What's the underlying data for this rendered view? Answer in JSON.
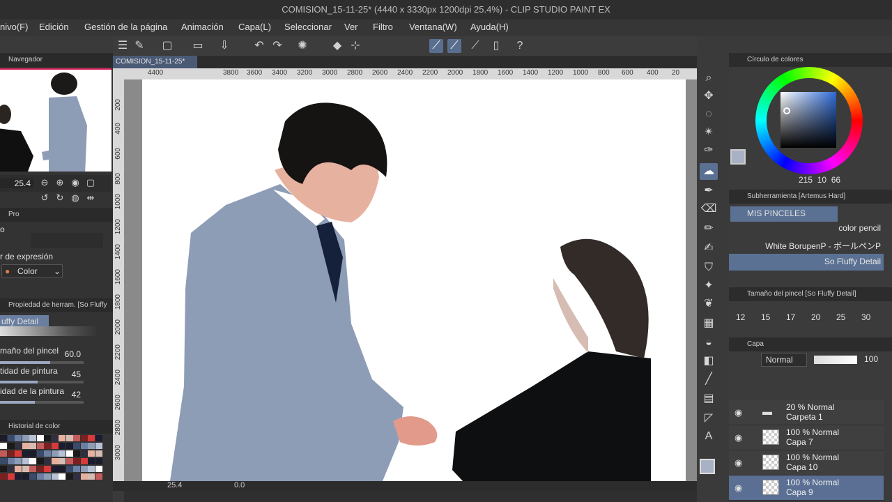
{
  "title": "COMISION_15-11-25* (4440 x 3330px 1200dpi 25.4%) - CLIP STUDIO PAINT EX",
  "menu": [
    "nivo(F)",
    "Edición",
    "Gestión de la página",
    "Animación",
    "Capa(L)",
    "Seleccionar",
    "Ver",
    "Filtro",
    "Ventana(W)",
    "Ayuda(H)"
  ],
  "navigator": {
    "title": "Navegador",
    "zoom": "25.4"
  },
  "left_panel": {
    "tab_prop": "Pro",
    "mode_label": "o",
    "expression_label": "r de expresión",
    "color_select": "Color",
    "tool_property_title": "Propiedad de herram. [So Fluffy D",
    "brush_name": "uffy Detail",
    "brush_size_label": "maño del pincel",
    "brush_size_value": "60.0",
    "paint_density_label": "tidad de pintura",
    "paint_density_value": "45",
    "paint_density2_label": "idad de la pintura",
    "paint_density2_value": "42",
    "color_history_title": "Historial de color"
  },
  "document": {
    "tab": "COMISION_15-11-25*",
    "ruler_h": [
      "4400",
      "3800",
      "3600",
      "3400",
      "3200",
      "3000",
      "2800",
      "2600",
      "2400",
      "2200",
      "2000",
      "1800",
      "1600",
      "1400",
      "1200",
      "1000",
      "800",
      "600",
      "400",
      "20"
    ],
    "ruler_v": [
      "200",
      "400",
      "600",
      "800",
      "1000",
      "1200",
      "1400",
      "1600",
      "1800",
      "2000",
      "2200",
      "2400",
      "2600",
      "2800",
      "3000"
    ],
    "status_zoom": "25.4",
    "status_angle": "0.0"
  },
  "color_wheel": {
    "title": "Círculo de colores",
    "h": "215",
    "s": "10",
    "v": "66",
    "main_color": "#a9b1c5"
  },
  "subtool": {
    "title": "Subherramienta [Artemus Hard]",
    "group": "MIS PINCELES",
    "brushes": [
      "color pencil",
      "White BorupenP - ボールペンP",
      "So Fluffy Detail"
    ]
  },
  "brush_size_panel": {
    "title": "Tamaño del pincel [So Fluffy Detail]",
    "sizes": [
      "12",
      "15",
      "17",
      "20",
      "25",
      "30"
    ]
  },
  "layers": {
    "title": "Capa",
    "blend_mode": "Normal",
    "opacity": "100",
    "rows": [
      {
        "line1": "20 % Normal",
        "line2": "Carpeta 1",
        "type": "folder"
      },
      {
        "line1": "100 % Normal",
        "line2": "Capa 7",
        "type": "layer"
      },
      {
        "line1": "100 % Normal",
        "line2": "Capa 10",
        "type": "layer"
      },
      {
        "line1": "100 % Normal",
        "line2": "Capa 9",
        "type": "layer"
      }
    ]
  },
  "colors": {
    "accent": "#5b7193",
    "suit": "#8e9db6",
    "dark": "#141414"
  }
}
